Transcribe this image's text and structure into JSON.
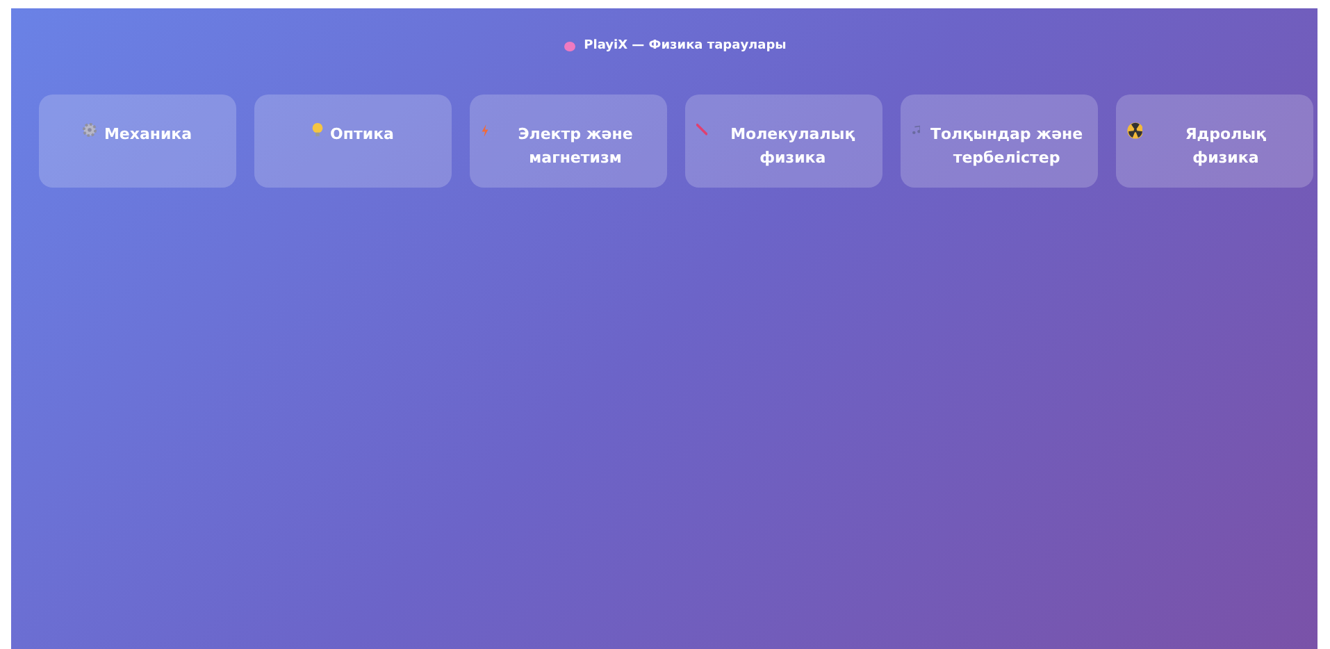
{
  "header": {
    "title": "PlayiX — Физика тараулары"
  },
  "topics": [
    {
      "label": "Механика"
    },
    {
      "label": "Оптика"
    },
    {
      "label": "Электр және магнетизм"
    },
    {
      "label": "Молекулалық физика"
    },
    {
      "label": "Толқындар және тербелістер"
    },
    {
      "label": "Ядролық физика"
    }
  ]
}
